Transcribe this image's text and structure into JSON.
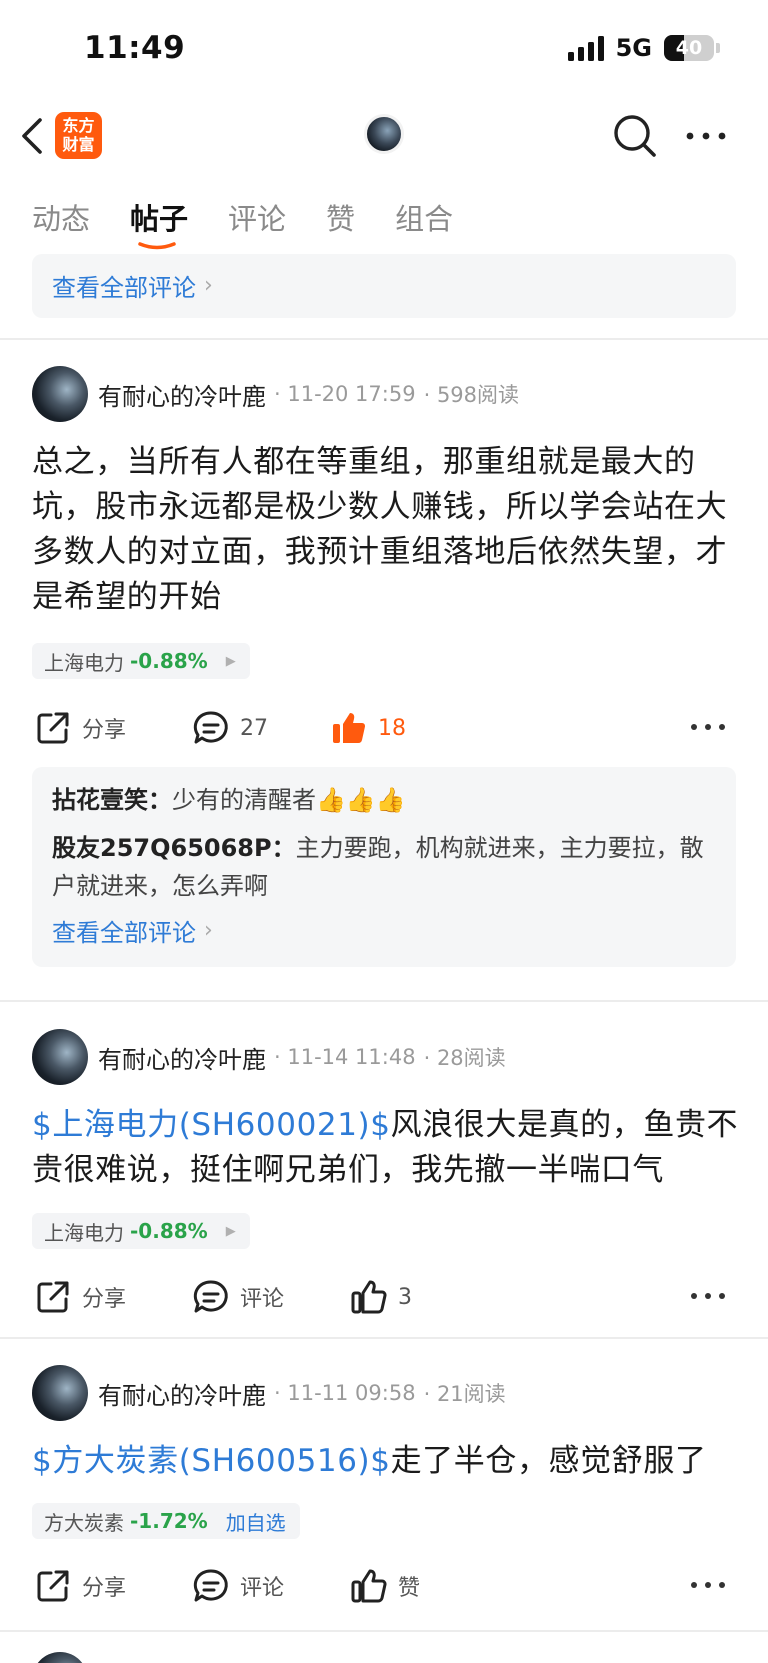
{
  "status": {
    "time": "11:49",
    "network": "5G",
    "battery": "40",
    "battery_level": 0.4
  },
  "nav": {
    "logo_text_line1": "东方",
    "logo_text_line2": "财富",
    "icons": [
      "back-icon",
      "search-icon",
      "more-icon"
    ]
  },
  "tabs": [
    {
      "label": "动态",
      "active": false
    },
    {
      "label": "帖子",
      "active": true
    },
    {
      "label": "评论",
      "active": false
    },
    {
      "label": "赞",
      "active": false
    },
    {
      "label": "组合",
      "active": false
    }
  ],
  "top_block": {
    "view_all": "查看全部评论"
  },
  "posts": [
    {
      "user": "有耐心的冷叶鹿",
      "time": "11-20 17:59",
      "reads": "598阅读",
      "text": "总之，当所有人都在等重组，那重组就是最大的坑，股市永远都是极少数人赚钱，所以学会站在大多数人的对立面，我预计重组落地后依然失望，才是希望的开始",
      "stock_name": "上海电力",
      "stock_change": "-0.88%",
      "share_label": "分享",
      "comment_label": "27",
      "like_label": "18",
      "liked": true,
      "replies": [
        {
          "who": "拈花壹笑：",
          "text": "少有的清醒者👍👍👍"
        },
        {
          "who": "股友257Q65068P：",
          "text": "主力要跑，机构就进来，主力要拉，散户就进来，怎么弄啊"
        }
      ],
      "view_all": "查看全部评论"
    },
    {
      "user": "有耐心的冷叶鹿",
      "time": "11-14 11:48",
      "reads": "28阅读",
      "tag": "$上海电力(SH600021)$",
      "text": "风浪很大是真的，鱼贵不贵很难说，挺住啊兄弟们，我先撤一半喘口气",
      "stock_name": "上海电力",
      "stock_change": "-0.88%",
      "share_label": "分享",
      "comment_label": "评论",
      "like_label": "3",
      "liked": false
    },
    {
      "user": "有耐心的冷叶鹿",
      "time": "11-11 09:58",
      "reads": "21阅读",
      "tag": "$方大炭素(SH600516)$",
      "text": "走了半仓，感觉舒服了",
      "stock_name": "方大炭素",
      "stock_change": "-1.72%",
      "add_watch": "加自选",
      "share_label": "分享",
      "comment_label": "评论",
      "like_label": "赞",
      "liked": false
    }
  ],
  "colors": {
    "accent_orange": "#ff5a0e",
    "link_blue": "#2e7bd6",
    "down_green": "#2aa34a"
  }
}
